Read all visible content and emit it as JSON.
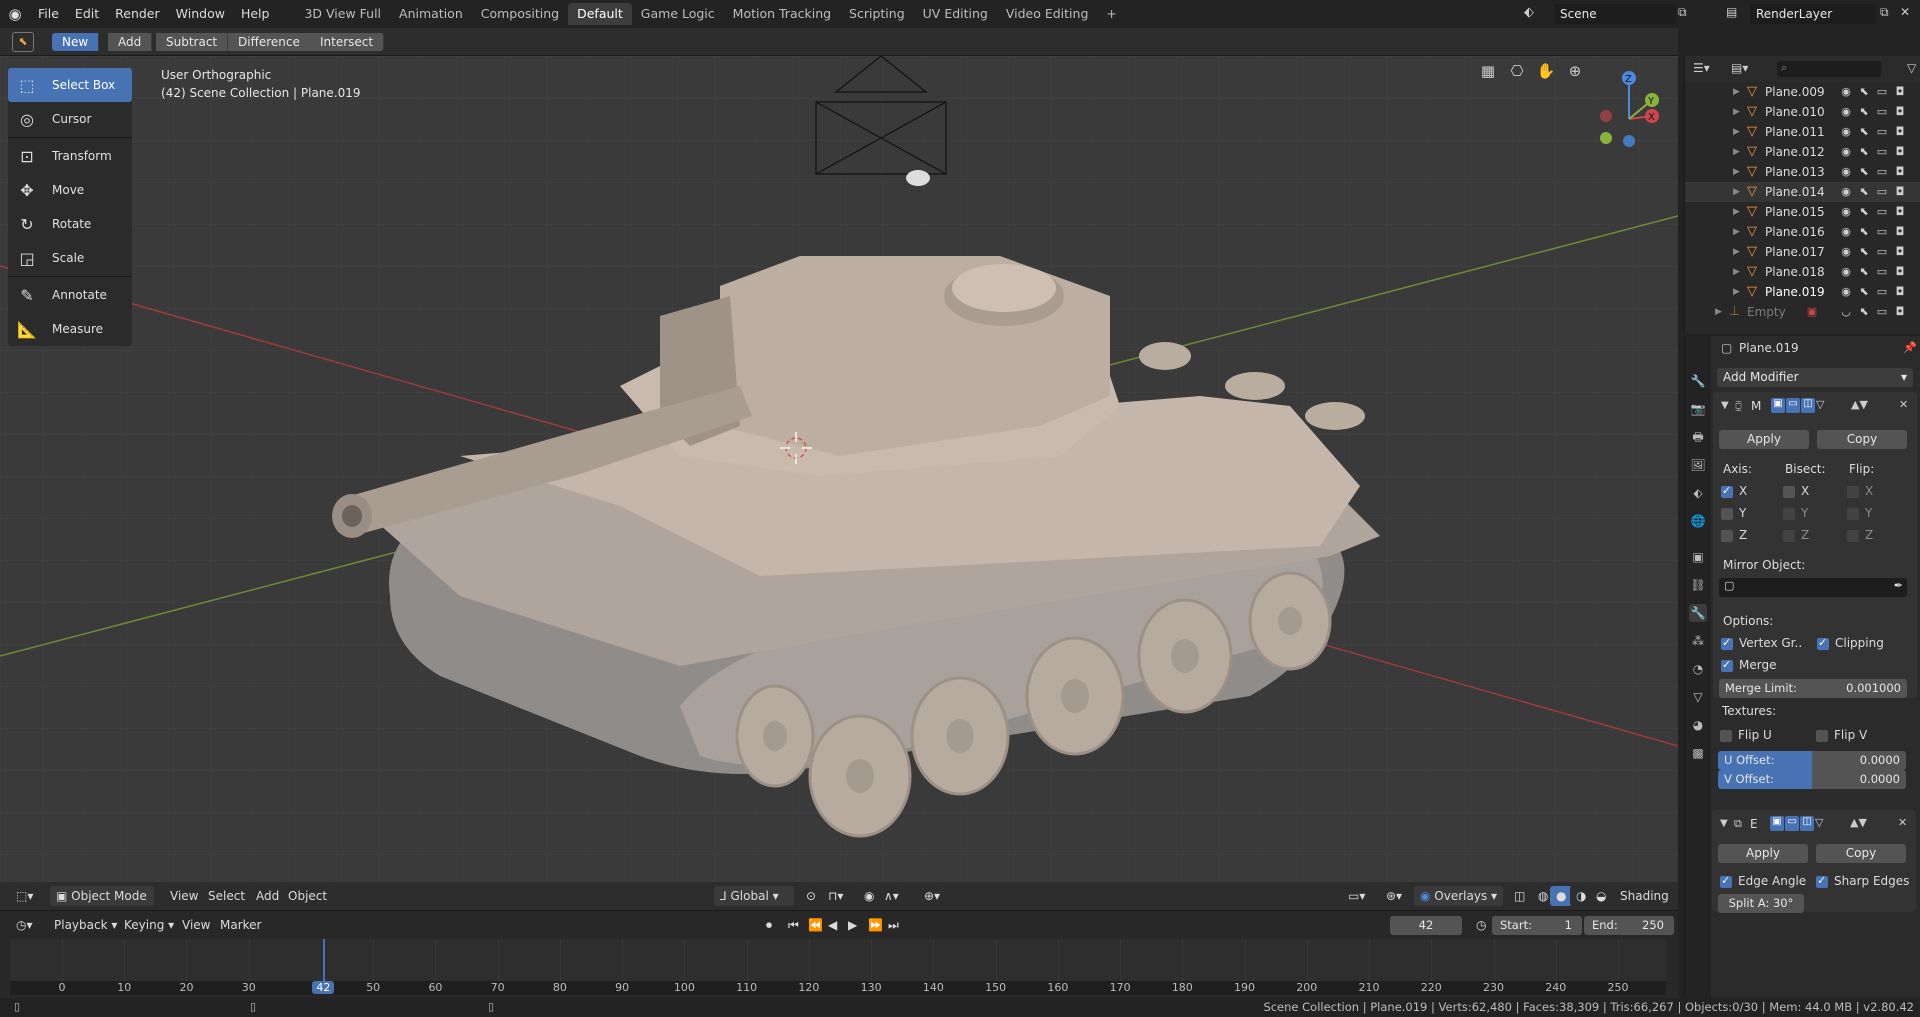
{
  "topbar": {
    "menus": [
      "File",
      "Edit",
      "Render",
      "Window",
      "Help"
    ],
    "workspaces": [
      "3D View Full",
      "Animation",
      "Compositing",
      "Default",
      "Game Logic",
      "Motion Tracking",
      "Scripting",
      "UV Editing",
      "Video Editing"
    ],
    "active_workspace": "Default",
    "add_tab": "+",
    "scene": "Scene",
    "render_layer": "RenderLayer"
  },
  "bool_tools": [
    "New",
    "Add",
    "Subtract",
    "Difference",
    "Intersect"
  ],
  "viewport": {
    "view_name": "User Orthographic",
    "collection_info": "(42) Scene Collection | Plane.019",
    "gizmo_axes": {
      "x": "X",
      "y": "Y",
      "z": "Z"
    }
  },
  "tools": [
    "Select Box",
    "Cursor",
    "Transform",
    "Move",
    "Rotate",
    "Scale",
    "Annotate",
    "Measure"
  ],
  "view_header": {
    "mode": "Object Mode",
    "menus": [
      "View",
      "Select",
      "Add",
      "Object"
    ],
    "orientation": "Global",
    "overlays": "Overlays",
    "shading": "Shading"
  },
  "timeline": {
    "menus": [
      "Playback",
      "Keying",
      "View",
      "Marker"
    ],
    "current_frame": "42",
    "start_label": "Start:",
    "start": "1",
    "end_label": "End:",
    "end": "250",
    "ticks": [
      "0",
      "10",
      "20",
      "30",
      "42",
      "50",
      "60",
      "70",
      "80",
      "90",
      "100",
      "110",
      "120",
      "130",
      "140",
      "150",
      "160",
      "170",
      "180",
      "190",
      "200",
      "210",
      "220",
      "230",
      "240",
      "250"
    ],
    "playhead_frame": 42,
    "range": [
      0,
      250
    ]
  },
  "outliner": {
    "rows": [
      "Plane.009",
      "Plane.010",
      "Plane.011",
      "Plane.012",
      "Plane.013",
      "Plane.014",
      "Plane.015",
      "Plane.016",
      "Plane.017",
      "Plane.018",
      "Plane.019"
    ],
    "empty_row": "Empty"
  },
  "properties": {
    "object_name": "Plane.019",
    "add_modifier": "Add Modifier",
    "mirror": {
      "short": "M",
      "apply": "Apply",
      "copy": "Copy",
      "axis_label": "Axis:",
      "bisect_label": "Bisect:",
      "flip_label": "Flip:",
      "x": "X",
      "y": "Y",
      "z": "Z",
      "mirror_object_label": "Mirror Object:",
      "options_label": "Options:",
      "vertex_groups": "Vertex Gr..",
      "clipping": "Clipping",
      "merge": "Merge",
      "merge_limit_label": "Merge Limit:",
      "merge_limit": "0.001000",
      "textures_label": "Textures:",
      "flip_u": "Flip U",
      "flip_v": "Flip V",
      "u_offset_label": "U Offset:",
      "u_offset": "0.0000",
      "v_offset_label": "V Offset:",
      "v_offset": "0.0000"
    },
    "edge_split": {
      "short": "E",
      "apply": "Apply",
      "copy": "Copy",
      "edge_angle": "Edge Angle",
      "sharp_edges": "Sharp Edges",
      "split_angle": "Split A: 30°"
    }
  },
  "status": "Scene Collection | Plane.019 | Verts:62,480 | Faces:38,309 | Tris:66,267 | Objects:0/30 | Mem: 44.0 MB | v2.80.42",
  "colors": {
    "accent": "#4772b3",
    "mesh": "#f09a3e",
    "x_axis": "#d0454d",
    "y_axis": "#8ab33e",
    "z_axis": "#4a8be0"
  }
}
